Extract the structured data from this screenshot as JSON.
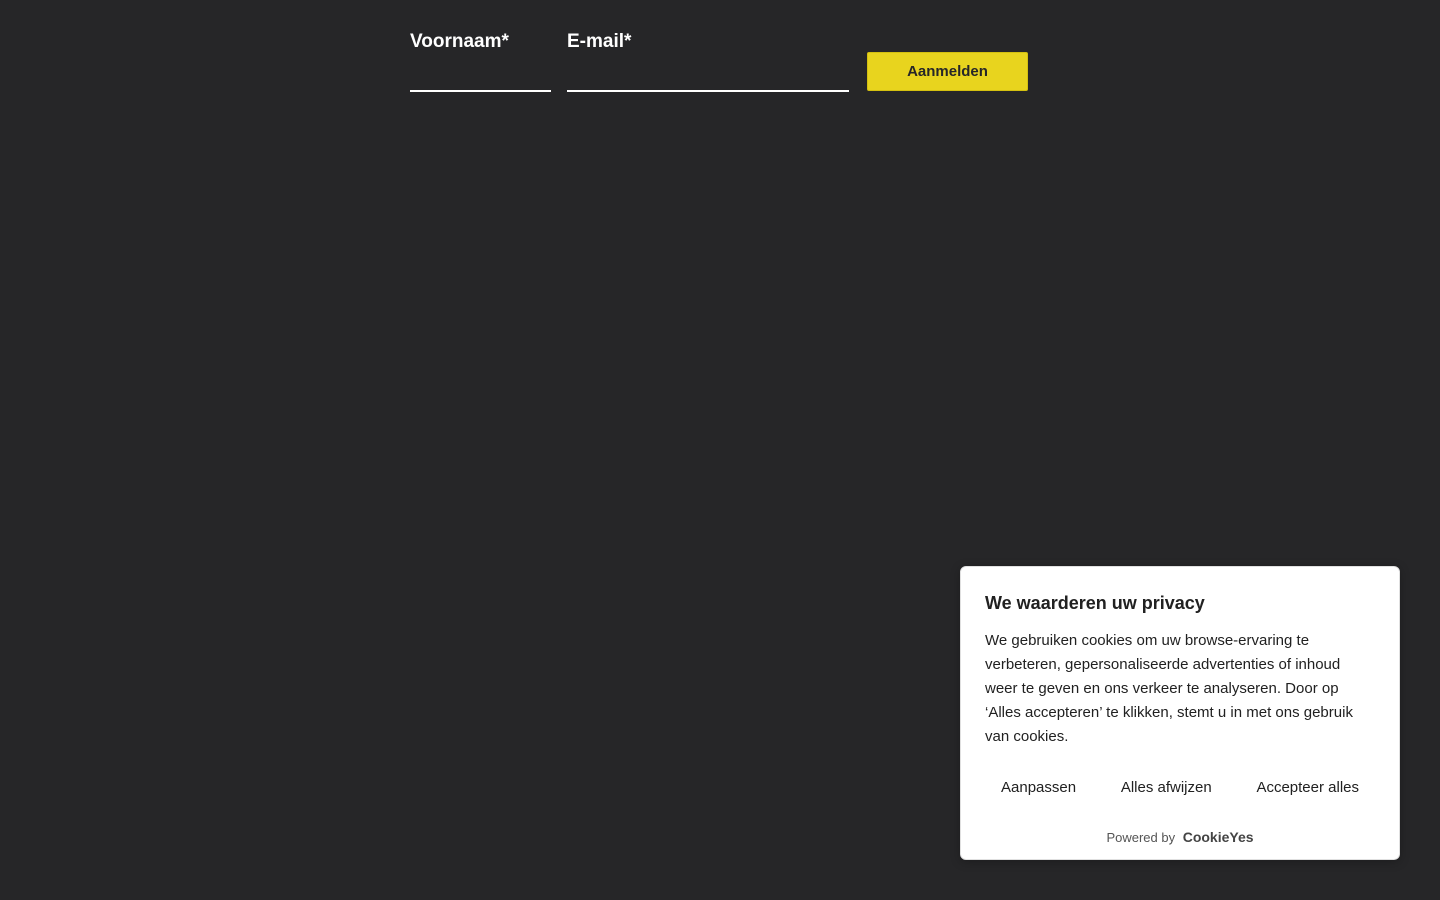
{
  "signup": {
    "firstname_label": "Voornaam*",
    "firstname_value": "",
    "email_label": "E-mail*",
    "email_value": "",
    "submit_label": "Aanmelden"
  },
  "cookie_banner": {
    "title": "We waarderen uw privacy",
    "text": "We gebruiken cookies om uw browse-ervaring te verbeteren, gepersonaliseerde advertenties of inhoud weer te geven en ons verkeer te analyseren. Door op ‘Alles accepteren’ te klikken, stemt u in met ons gebruik van cookies.",
    "customize_label": "Aanpassen",
    "reject_label": "Alles afwijzen",
    "accept_label": "Accepteer alles",
    "powered_by": "Powered by",
    "logo_text": "CookieYes"
  },
  "colors": {
    "background": "#262628",
    "accent": "#e8d41e",
    "banner_background": "#ffffff"
  }
}
